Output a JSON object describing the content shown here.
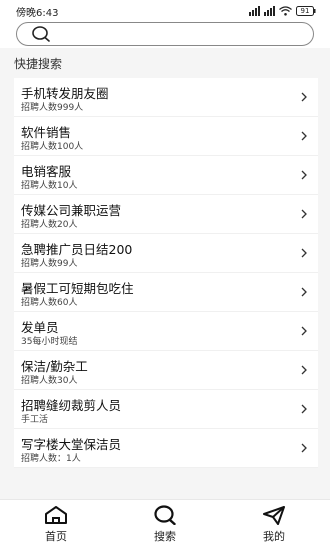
{
  "status_bar": {
    "time": "傍晚6:43",
    "battery": "91"
  },
  "search": {
    "placeholder": ""
  },
  "quick_search": {
    "title": "快捷搜索",
    "items": [
      {
        "title": "手机转发朋友圈",
        "subtitle": "招聘人数999人"
      },
      {
        "title": "软件销售",
        "subtitle": "招聘人数100人"
      },
      {
        "title": "电销客服",
        "subtitle": "招聘人数10人"
      },
      {
        "title": "传媒公司兼职运营",
        "subtitle": "招聘人数20人"
      },
      {
        "title": "急聘推广员日结200",
        "subtitle": "招聘人数99人"
      },
      {
        "title": "暑假工可短期包吃住",
        "subtitle": "招聘人数60人"
      },
      {
        "title": "发单员",
        "subtitle": "35每小时现结"
      },
      {
        "title": "保洁/勤杂工",
        "subtitle": "招聘人数30人"
      },
      {
        "title": "招聘缝纫裁剪人员",
        "subtitle": "手工活"
      },
      {
        "title": "写字楼大堂保洁员",
        "subtitle": "招聘人数：1人"
      }
    ]
  },
  "tabbar": {
    "home": "首页",
    "search": "搜索",
    "mine": "我的"
  },
  "icons": [
    "signal-icon",
    "wifi-icon",
    "battery-icon",
    "search-icon",
    "chevron-right-icon",
    "home-icon",
    "search-icon",
    "send-icon"
  ]
}
